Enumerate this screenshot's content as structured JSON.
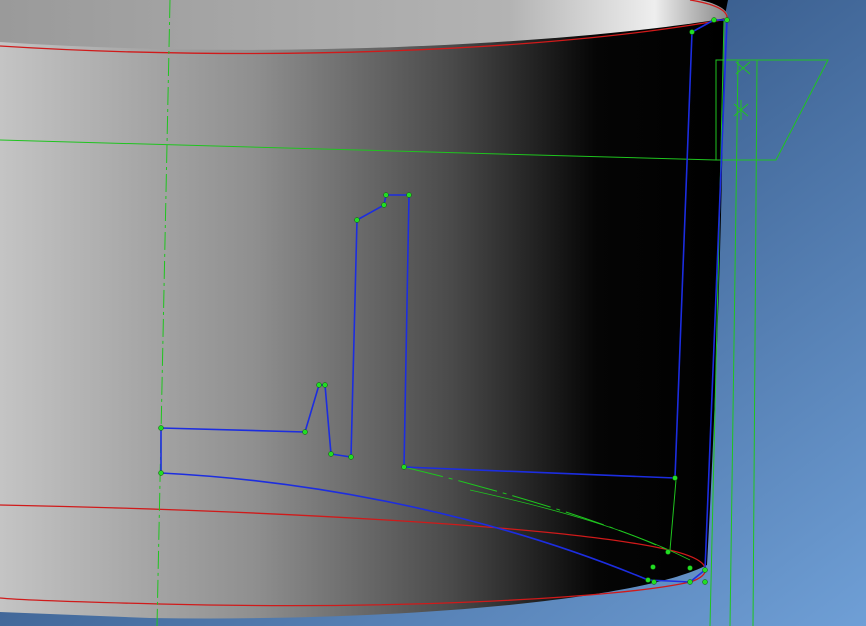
{
  "viewport": {
    "background_top": "#17335f",
    "background_bottom": "#6f9fd6",
    "body_light": "#c4c4c4",
    "body_dark": "#000000",
    "edge_color": "#d01a1a",
    "sketch_color": "#1c2de0",
    "construction_color": "#1fc41f",
    "point_color": "#22dd22"
  },
  "scene": {
    "objects": [
      {
        "name": "cylinder-body"
      },
      {
        "name": "top-edge-ellipse"
      },
      {
        "name": "bottom-edge-ellipse"
      },
      {
        "name": "blue-profile-sketch"
      },
      {
        "name": "sketch-plane"
      },
      {
        "name": "construction-lines"
      }
    ]
  }
}
